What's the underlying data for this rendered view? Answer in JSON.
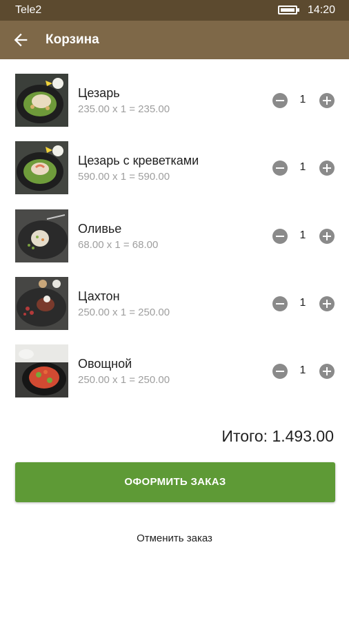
{
  "status_bar": {
    "carrier": "Tele2",
    "time": "14:20"
  },
  "app_bar": {
    "title": "Корзина"
  },
  "cart": {
    "items": [
      {
        "name": "Цезарь",
        "price_line": "235.00 x 1 = 235.00",
        "quantity": "1"
      },
      {
        "name": "Цезарь с креветками",
        "price_line": "590.00 x 1 = 590.00",
        "quantity": "1"
      },
      {
        "name": "Оливье",
        "price_line": "68.00 x 1 = 68.00",
        "quantity": "1"
      },
      {
        "name": "Цахтон",
        "price_line": "250.00 x 1 = 250.00",
        "quantity": "1"
      },
      {
        "name": "Овощной",
        "price_line": "250.00 x 1 = 250.00",
        "quantity": "1"
      }
    ],
    "total": "Итого: 1.493.00"
  },
  "actions": {
    "order_label": "ОФОРМИТЬ ЗАКАЗ",
    "cancel_label": "Отменить заказ"
  },
  "colors": {
    "status_bar": "#5c4a2f",
    "app_bar": "#7e6848",
    "order_button": "#5e9a36",
    "qty_button": "#8a8a8a"
  }
}
